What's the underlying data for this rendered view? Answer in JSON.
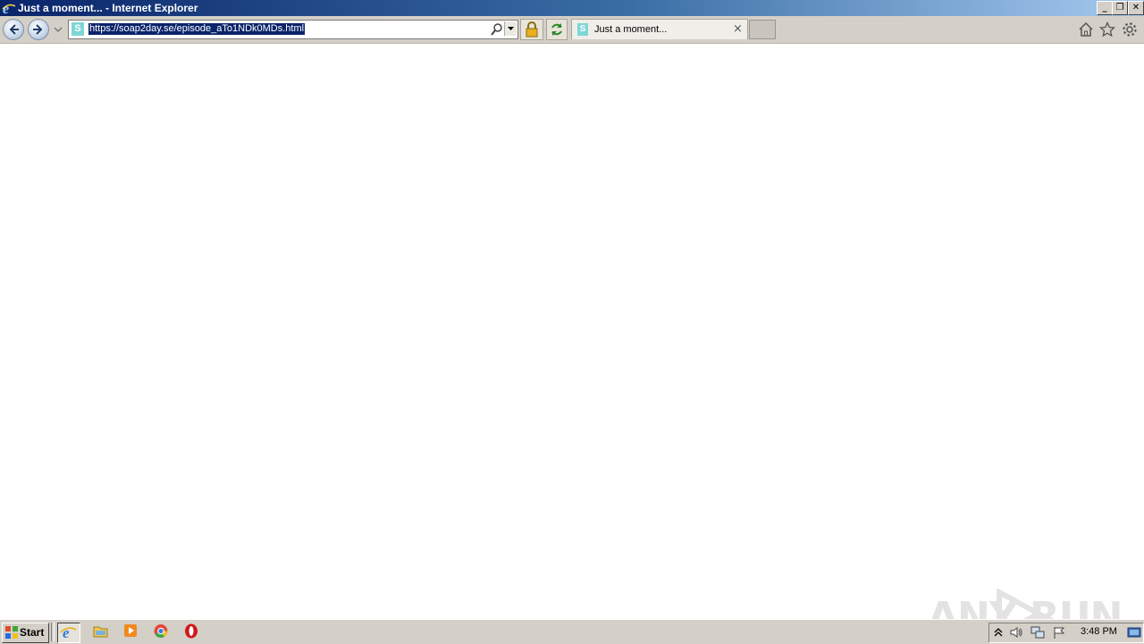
{
  "window": {
    "title": "Just a moment... - Internet Explorer",
    "buttons": {
      "minimize": "_",
      "restore": "❐",
      "close": "✕"
    }
  },
  "toolbar": {
    "address_url": "https://soap2day.se/episode_aTo1NDk0MDs.html",
    "favicon_letter": "S",
    "tab": {
      "label": "Just a moment...",
      "favicon_letter": "S",
      "close": "×"
    },
    "icons": [
      "back-icon",
      "forward-icon",
      "search-icon",
      "lock-icon",
      "refresh-icon",
      "home-icon",
      "favorites-star-icon",
      "settings-gear-icon"
    ]
  },
  "watermark": {
    "left_text": "ANY",
    "right_text": "RUN"
  },
  "taskbar": {
    "start_label": "Start",
    "pinned": [
      "internet-explorer-icon",
      "file-explorer-icon",
      "media-player-icon",
      "chrome-icon",
      "opera-icon"
    ],
    "tray": [
      "show-hidden-icons-icon",
      "volume-icon",
      "network-icon",
      "action-center-flag-icon",
      "show-desktop-icon"
    ],
    "clock": "3:48 PM"
  },
  "colors": {
    "titlebar_start": "#0a246a",
    "titlebar_end": "#a6caf0",
    "chrome": "#d4d0c8",
    "selection": "#0a246a"
  }
}
